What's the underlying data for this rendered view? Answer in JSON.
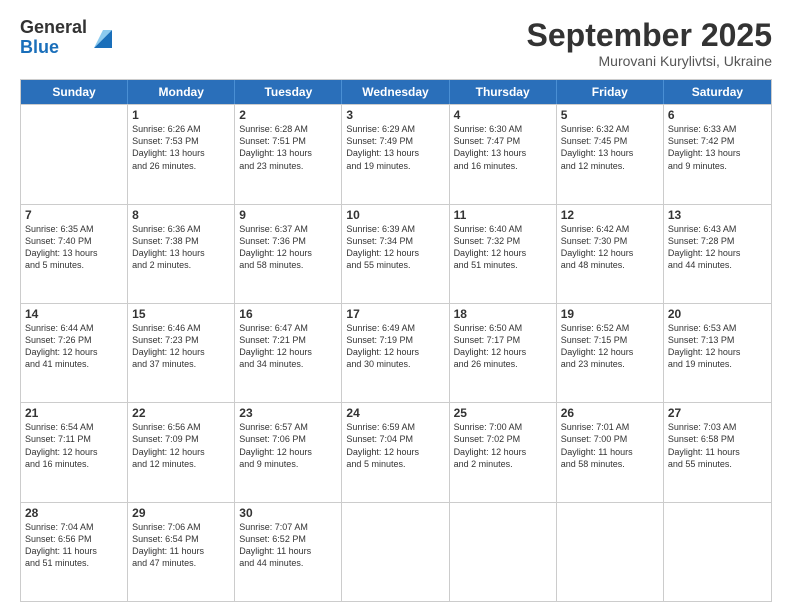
{
  "logo": {
    "general": "General",
    "blue": "Blue"
  },
  "header": {
    "month": "September 2025",
    "location": "Murovani Kurylivtsi, Ukraine"
  },
  "days": [
    "Sunday",
    "Monday",
    "Tuesday",
    "Wednesday",
    "Thursday",
    "Friday",
    "Saturday"
  ],
  "weeks": [
    [
      {
        "day": "",
        "info": ""
      },
      {
        "day": "1",
        "info": "Sunrise: 6:26 AM\nSunset: 7:53 PM\nDaylight: 13 hours\nand 26 minutes."
      },
      {
        "day": "2",
        "info": "Sunrise: 6:28 AM\nSunset: 7:51 PM\nDaylight: 13 hours\nand 23 minutes."
      },
      {
        "day": "3",
        "info": "Sunrise: 6:29 AM\nSunset: 7:49 PM\nDaylight: 13 hours\nand 19 minutes."
      },
      {
        "day": "4",
        "info": "Sunrise: 6:30 AM\nSunset: 7:47 PM\nDaylight: 13 hours\nand 16 minutes."
      },
      {
        "day": "5",
        "info": "Sunrise: 6:32 AM\nSunset: 7:45 PM\nDaylight: 13 hours\nand 12 minutes."
      },
      {
        "day": "6",
        "info": "Sunrise: 6:33 AM\nSunset: 7:42 PM\nDaylight: 13 hours\nand 9 minutes."
      }
    ],
    [
      {
        "day": "7",
        "info": "Sunrise: 6:35 AM\nSunset: 7:40 PM\nDaylight: 13 hours\nand 5 minutes."
      },
      {
        "day": "8",
        "info": "Sunrise: 6:36 AM\nSunset: 7:38 PM\nDaylight: 13 hours\nand 2 minutes."
      },
      {
        "day": "9",
        "info": "Sunrise: 6:37 AM\nSunset: 7:36 PM\nDaylight: 12 hours\nand 58 minutes."
      },
      {
        "day": "10",
        "info": "Sunrise: 6:39 AM\nSunset: 7:34 PM\nDaylight: 12 hours\nand 55 minutes."
      },
      {
        "day": "11",
        "info": "Sunrise: 6:40 AM\nSunset: 7:32 PM\nDaylight: 12 hours\nand 51 minutes."
      },
      {
        "day": "12",
        "info": "Sunrise: 6:42 AM\nSunset: 7:30 PM\nDaylight: 12 hours\nand 48 minutes."
      },
      {
        "day": "13",
        "info": "Sunrise: 6:43 AM\nSunset: 7:28 PM\nDaylight: 12 hours\nand 44 minutes."
      }
    ],
    [
      {
        "day": "14",
        "info": "Sunrise: 6:44 AM\nSunset: 7:26 PM\nDaylight: 12 hours\nand 41 minutes."
      },
      {
        "day": "15",
        "info": "Sunrise: 6:46 AM\nSunset: 7:23 PM\nDaylight: 12 hours\nand 37 minutes."
      },
      {
        "day": "16",
        "info": "Sunrise: 6:47 AM\nSunset: 7:21 PM\nDaylight: 12 hours\nand 34 minutes."
      },
      {
        "day": "17",
        "info": "Sunrise: 6:49 AM\nSunset: 7:19 PM\nDaylight: 12 hours\nand 30 minutes."
      },
      {
        "day": "18",
        "info": "Sunrise: 6:50 AM\nSunset: 7:17 PM\nDaylight: 12 hours\nand 26 minutes."
      },
      {
        "day": "19",
        "info": "Sunrise: 6:52 AM\nSunset: 7:15 PM\nDaylight: 12 hours\nand 23 minutes."
      },
      {
        "day": "20",
        "info": "Sunrise: 6:53 AM\nSunset: 7:13 PM\nDaylight: 12 hours\nand 19 minutes."
      }
    ],
    [
      {
        "day": "21",
        "info": "Sunrise: 6:54 AM\nSunset: 7:11 PM\nDaylight: 12 hours\nand 16 minutes."
      },
      {
        "day": "22",
        "info": "Sunrise: 6:56 AM\nSunset: 7:09 PM\nDaylight: 12 hours\nand 12 minutes."
      },
      {
        "day": "23",
        "info": "Sunrise: 6:57 AM\nSunset: 7:06 PM\nDaylight: 12 hours\nand 9 minutes."
      },
      {
        "day": "24",
        "info": "Sunrise: 6:59 AM\nSunset: 7:04 PM\nDaylight: 12 hours\nand 5 minutes."
      },
      {
        "day": "25",
        "info": "Sunrise: 7:00 AM\nSunset: 7:02 PM\nDaylight: 12 hours\nand 2 minutes."
      },
      {
        "day": "26",
        "info": "Sunrise: 7:01 AM\nSunset: 7:00 PM\nDaylight: 11 hours\nand 58 minutes."
      },
      {
        "day": "27",
        "info": "Sunrise: 7:03 AM\nSunset: 6:58 PM\nDaylight: 11 hours\nand 55 minutes."
      }
    ],
    [
      {
        "day": "28",
        "info": "Sunrise: 7:04 AM\nSunset: 6:56 PM\nDaylight: 11 hours\nand 51 minutes."
      },
      {
        "day": "29",
        "info": "Sunrise: 7:06 AM\nSunset: 6:54 PM\nDaylight: 11 hours\nand 47 minutes."
      },
      {
        "day": "30",
        "info": "Sunrise: 7:07 AM\nSunset: 6:52 PM\nDaylight: 11 hours\nand 44 minutes."
      },
      {
        "day": "",
        "info": ""
      },
      {
        "day": "",
        "info": ""
      },
      {
        "day": "",
        "info": ""
      },
      {
        "day": "",
        "info": ""
      }
    ]
  ]
}
